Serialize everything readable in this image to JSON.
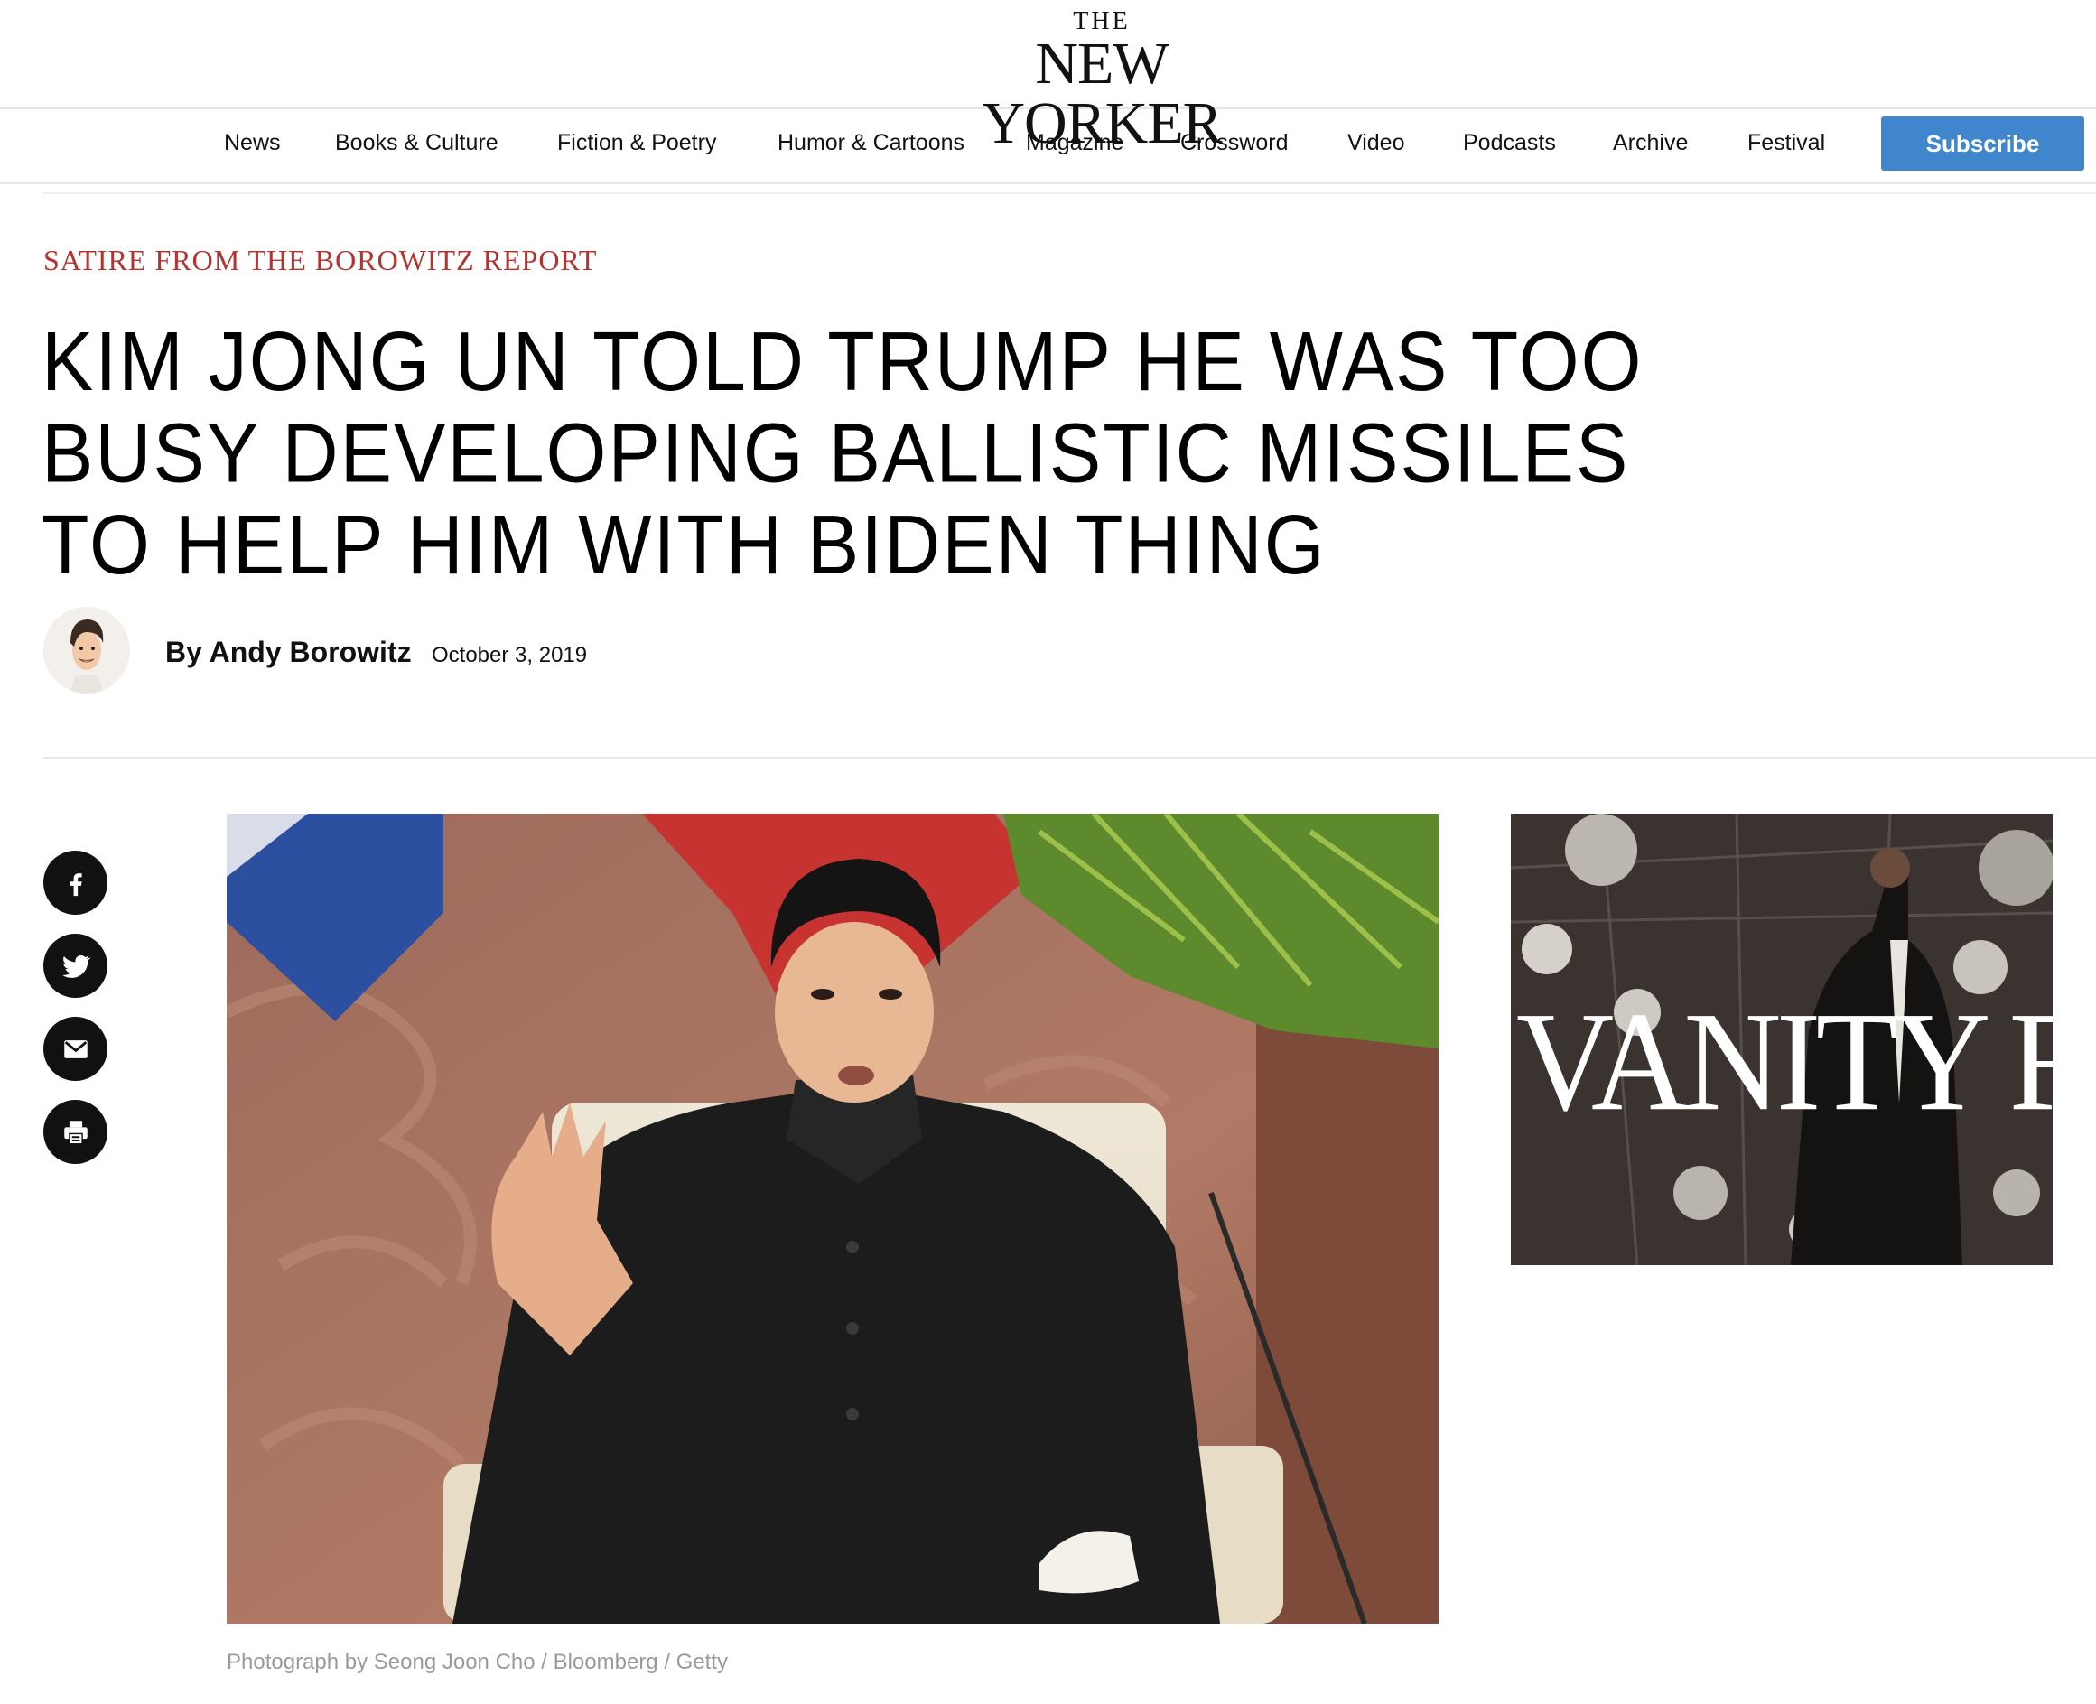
{
  "masthead": {
    "logo_line1": "THE",
    "logo_line2": "NEW YORKER"
  },
  "nav": {
    "items": [
      "News",
      "Books & Culture",
      "Fiction & Poetry",
      "Humor & Cartoons",
      "Magazine",
      "Crossword",
      "Video",
      "Podcasts",
      "Archive",
      "Festival"
    ],
    "subscribe_label": "Subscribe"
  },
  "article": {
    "rubric": "SATIRE FROM THE BOROWITZ REPORT",
    "headline": "KIM JONG UN TOLD TRUMP HE WAS TOO BUSY DEVELOPING BALLISTIC MISSILES TO HELP HIM WITH BIDEN THING",
    "byline": "By Andy Borowitz",
    "date": "October 3, 2019",
    "photo_caption": "Photograph by Seong Joon Cho / Bloomberg / Getty"
  },
  "share": {
    "icons": [
      "facebook-icon",
      "twitter-icon",
      "email-icon",
      "print-icon"
    ]
  },
  "ad": {
    "text": "VANITY FAI"
  },
  "colors": {
    "accent_red": "#b5322f",
    "subscribe_blue": "#3f86cc"
  }
}
